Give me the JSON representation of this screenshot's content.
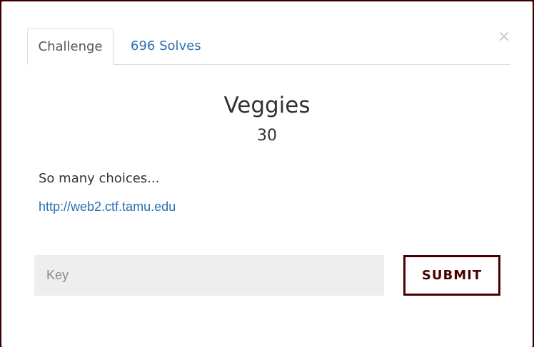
{
  "tabs": [
    {
      "label": "Challenge",
      "active": true
    },
    {
      "label": "696 Solves",
      "active": false
    }
  ],
  "close_icon": "×",
  "challenge": {
    "name": "Veggies",
    "value": "30",
    "description": "So many choices...",
    "link": "http://web2.ctf.tamu.edu"
  },
  "form": {
    "key_placeholder": "Key",
    "submit_label": "SUBMIT"
  },
  "colors": {
    "accent": "#4b0000",
    "link": "#2a6fb0",
    "input_bg": "#eeeeee"
  }
}
